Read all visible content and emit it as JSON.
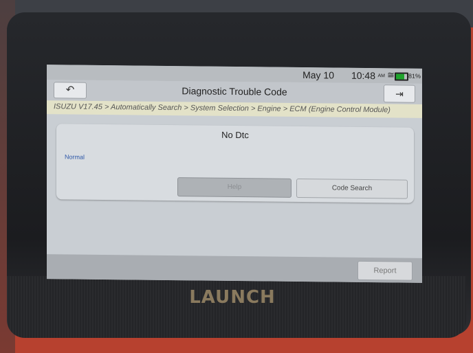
{
  "status_bar": {
    "date": "May 10",
    "time": "10:48",
    "ampm": "AM",
    "battery_percent": "81%",
    "battery_color": "#1ea32c"
  },
  "header": {
    "back_icon": "back-arrow-icon",
    "title": "Diagnostic Trouble Code",
    "exit_icon": "exit-icon"
  },
  "breadcrumb": "ISUZU V17.45 > Automatically Search > System Selection > Engine > ECM (Engine Control Module)",
  "panel": {
    "dtc_text": "No Dtc",
    "status": "Normal",
    "help_label": "Help",
    "code_search_label": "Code Search"
  },
  "footer": {
    "report_label": "Report"
  },
  "device": {
    "brand": "LAUNCH"
  }
}
